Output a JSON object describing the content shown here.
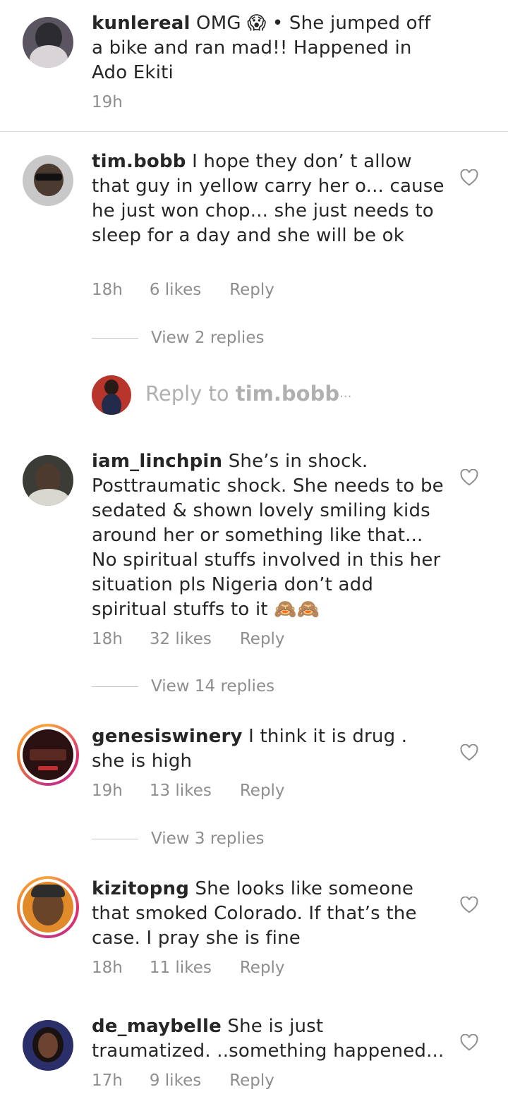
{
  "caption": {
    "username": "kunlereal",
    "text": "OMG 😱 • She jumped off a bike and ran mad!! Happened in Ado Ekiti",
    "time": "19h"
  },
  "comments": [
    {
      "username": "tim.bobb",
      "text": "I hope they don’ t allow that guy in yellow carry her o... cause he just won chop... she just needs to sleep for a day and she will be ok",
      "time": "18h",
      "likes": "6 likes",
      "reply": "Reply",
      "view_replies": "View 2 replies"
    },
    {
      "username": "iam_linchpin",
      "text": "She’s in shock. Posttraumatic shock. She needs to be sedated & shown lovely smiling kids around her or something like that... No spiritual stuffs involved in this her situation pls Nigeria don’t add spiritual stuffs to it 🙈🙈",
      "time": "18h",
      "likes": "32 likes",
      "reply": "Reply",
      "view_replies": "View 14 replies"
    },
    {
      "username": "genesiswinery",
      "text": "I think it is drug . she is high",
      "time": "19h",
      "likes": "13 likes",
      "reply": "Reply",
      "view_replies": "View 3 replies"
    },
    {
      "username": "kizitopng",
      "text": "She looks like someone that smoked Colorado. If that’s the case. I pray she is fine",
      "time": "18h",
      "likes": "11 likes",
      "reply": "Reply"
    },
    {
      "username": "de_maybelle",
      "text": "She is just traumatized. ..something happened...",
      "time": "17h",
      "likes": "9 likes",
      "reply": "Reply"
    }
  ],
  "reply_box": {
    "prefix": "Reply to",
    "target": "tim.bobb",
    "suffix": "···"
  },
  "icons": {
    "like": "heart-outline-icon"
  },
  "colors": {
    "text": "#262626",
    "secondary": "#8e8e8e",
    "story_ring": "#e1306c"
  }
}
